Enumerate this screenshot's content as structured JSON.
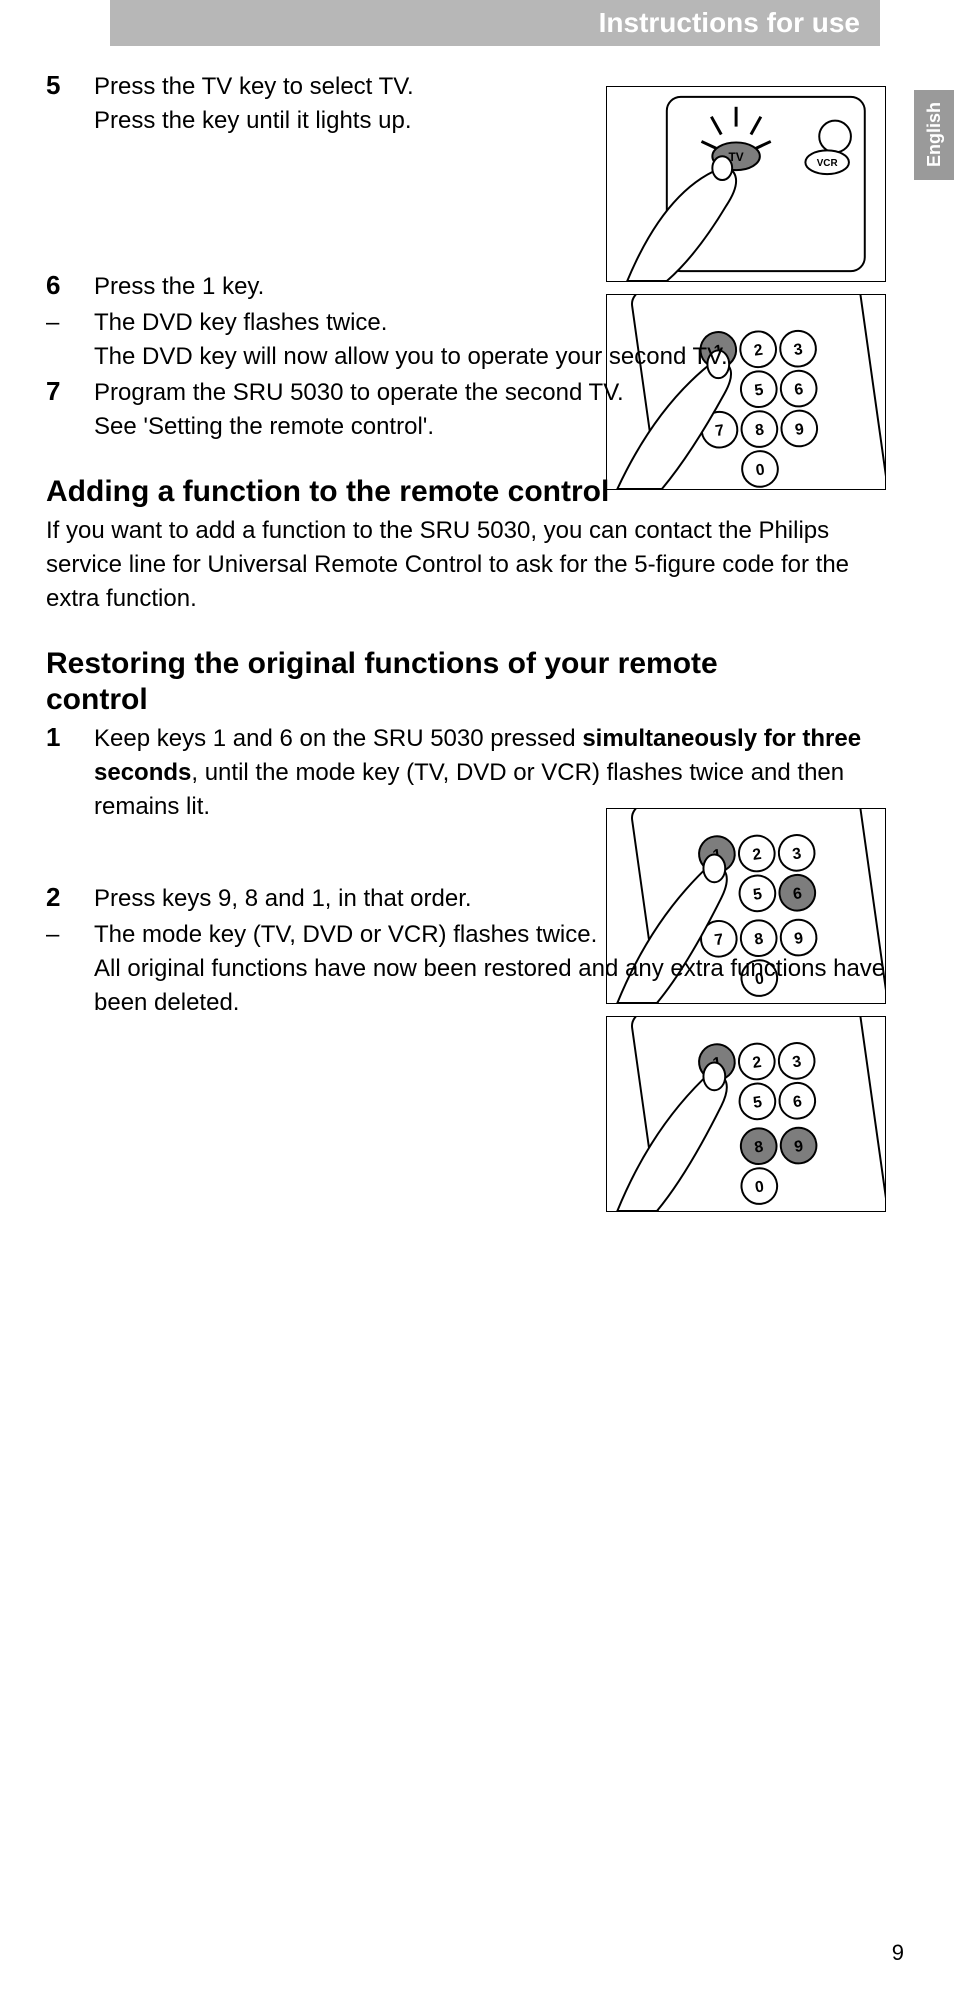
{
  "header": {
    "title": "Instructions for use"
  },
  "lang_tab": "English",
  "page_number": "9",
  "steps_a": {
    "s5": {
      "num": "5",
      "l1": "Press the TV key to select TV.",
      "l2": "Press the key until it lights up."
    },
    "s6": {
      "num": "6",
      "l1": "Press the 1 key."
    },
    "s6dash": {
      "mark": "–",
      "l1": "The DVD key flashes twice.",
      "l2": "The DVD key will now allow you to operate your second TV."
    },
    "s7": {
      "num": "7",
      "l1": "Program the SRU 5030 to operate the second TV.",
      "l2": "See 'Setting the remote control'."
    }
  },
  "section_b": {
    "heading": "Adding a function to the remote control",
    "body": "If you want to add a function to the SRU 5030, you can contact the Philips service line for Universal Remote Control to ask for the 5-figure code for the extra function."
  },
  "section_c": {
    "heading": "Restoring the original functions of your remote control",
    "s1": {
      "num": "1",
      "pre": "Keep keys 1 and 6 on the SRU 5030 pressed ",
      "bold": "simultaneously for three seconds",
      "post": ", until the mode key (TV, DVD or VCR) flashes twice and then remains lit."
    },
    "s2": {
      "num": "2",
      "l1": "Press keys 9, 8 and 1, in that order."
    },
    "s2dash": {
      "mark": "–",
      "l1": "The mode key (TV, DVD or VCR) flashes twice.",
      "l2": "All original functions have now been restored and any extra functions have been deleted."
    }
  }
}
